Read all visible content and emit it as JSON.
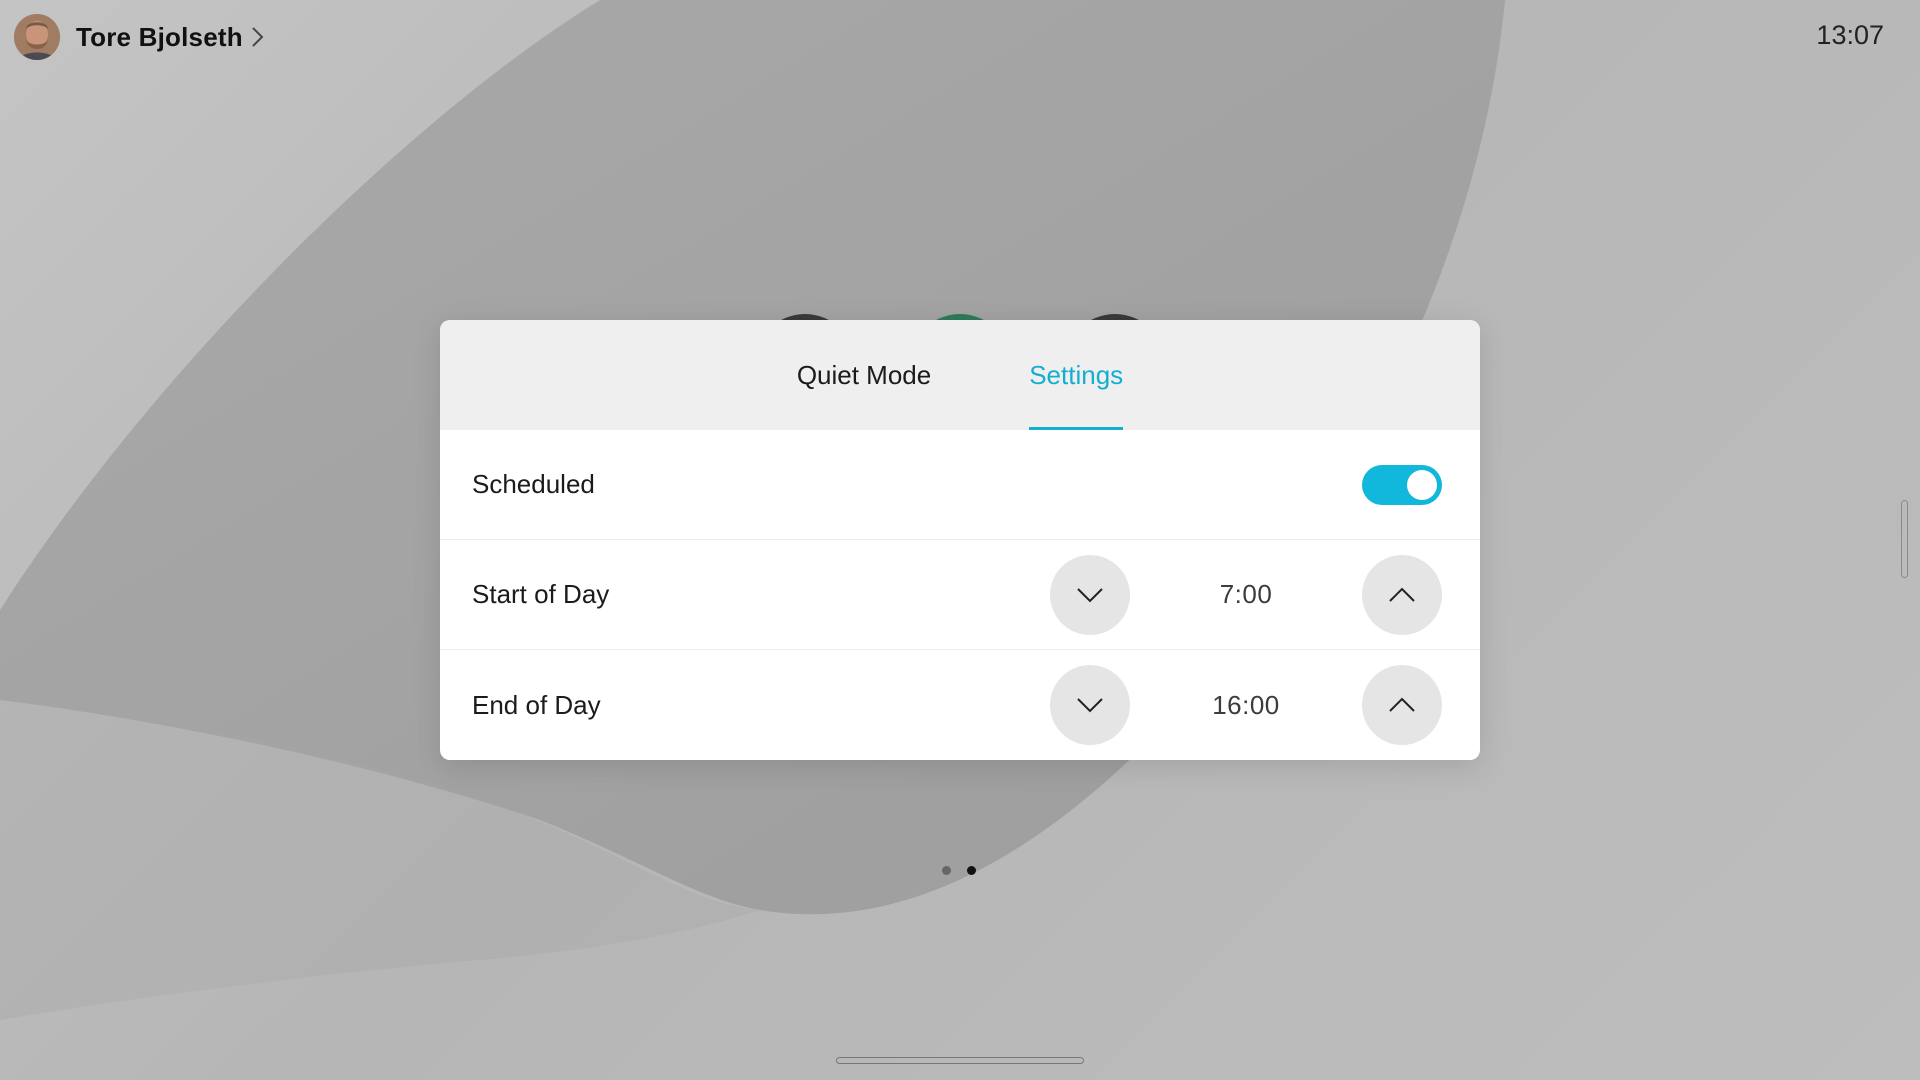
{
  "header": {
    "user_name": "Tore Bjolseth",
    "clock": "13:07"
  },
  "panel": {
    "tabs": [
      {
        "label": "Quiet Mode",
        "active": false
      },
      {
        "label": "Settings",
        "active": true
      }
    ],
    "scheduled": {
      "label": "Scheduled",
      "enabled": true
    },
    "start_of_day": {
      "label": "Start of Day",
      "value": "7:00"
    },
    "end_of_day": {
      "label": "End of Day",
      "value": "16:00"
    }
  },
  "pager": {
    "pages": 2,
    "current": 2
  },
  "colors": {
    "accent": "#12afd0",
    "toggle_on": "#12b7dc",
    "stepper_button": "#e5e5e5",
    "panel_header": "#efefef"
  },
  "icons": {
    "profile_chevron": "chevron-right-icon",
    "decrease": "chevron-down-icon",
    "increase": "chevron-up-icon"
  }
}
